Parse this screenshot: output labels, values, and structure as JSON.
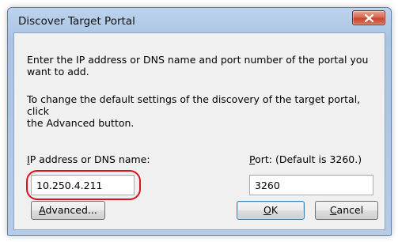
{
  "window": {
    "title": "Discover Target Portal",
    "close_icon": "close-icon"
  },
  "instructions": {
    "line1": "Enter the IP address or DNS name and port number of the portal you",
    "line2": "want to add.",
    "line3": "To change the default settings of the discovery of the target portal, click",
    "line4": "the Advanced button."
  },
  "ip": {
    "label_mnemonic": "I",
    "label_rest": "P address or DNS name:",
    "value": "10.250.4.211"
  },
  "port": {
    "label_mnemonic": "P",
    "label_rest": "ort: (Default is 3260.)",
    "value": "3260"
  },
  "buttons": {
    "advanced_mnemonic": "A",
    "advanced_rest": "dvanced...",
    "ok_mnemonic": "O",
    "ok_rest": "K",
    "cancel_mnemonic": "C",
    "cancel_rest": "ancel"
  },
  "colors": {
    "highlight": "#d4141e",
    "close_button": "#c7472b"
  }
}
